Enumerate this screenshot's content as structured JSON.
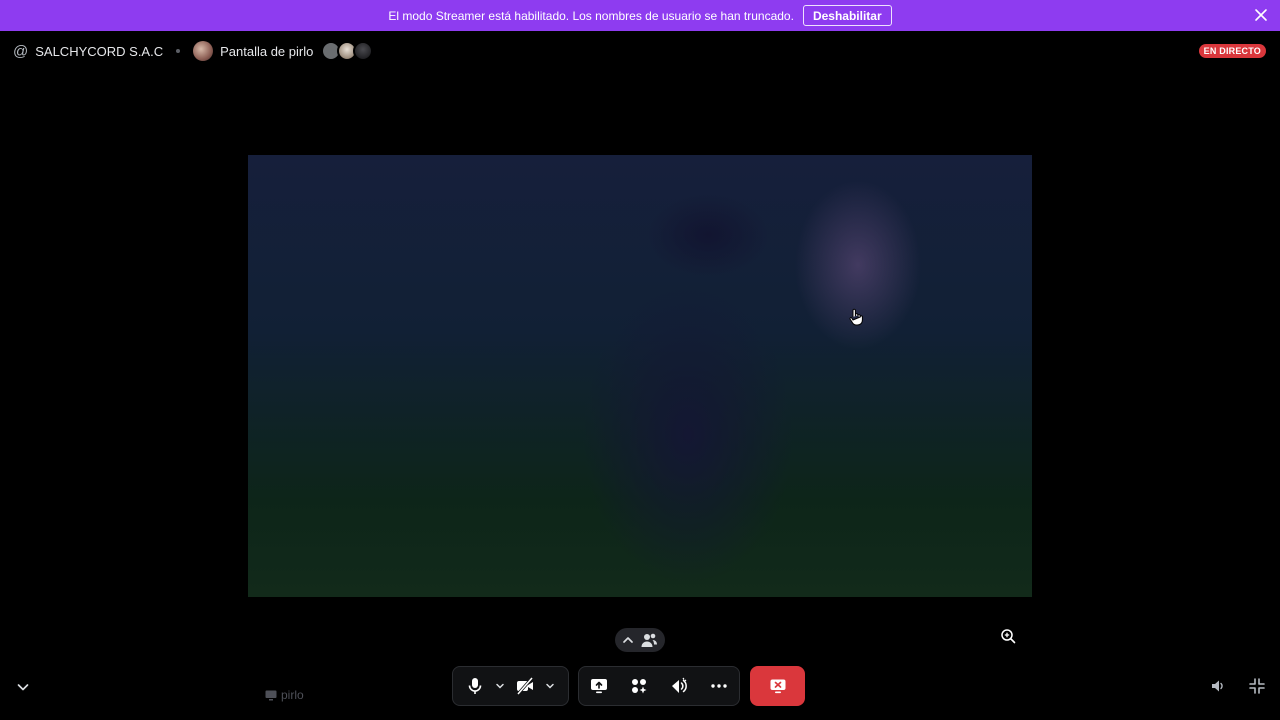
{
  "banner": {
    "message": "El modo Streamer está habilitado. Los nombres de usuario se han truncado.",
    "button_label": "Deshabilitar",
    "color": "#8e3cf0"
  },
  "header": {
    "server_name": "SALCHYCORD S.A.C",
    "channel_name": "Pantalla de pirlo",
    "viewer_count_shown": 3
  },
  "live_badge": "EN DIRECTO",
  "stream_owner": "pirlo",
  "controls": {
    "microphone": "microphone-icon",
    "camera": "camera-off-icon",
    "screen_share": "screen-share-icon",
    "activities": "activities-icon",
    "soundboard": "soundboard-icon",
    "more": "more-icon",
    "stop_stream": "stop-stream-icon"
  },
  "colors": {
    "accent_danger": "#da373c",
    "bar_background": "#111214"
  }
}
